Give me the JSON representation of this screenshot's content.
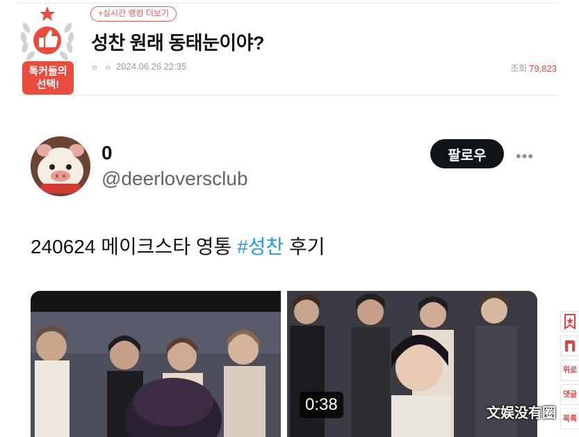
{
  "header": {
    "badge_text": [
      "톡커들의",
      "선택!"
    ],
    "ranking_link": "+실시간 랭킹 더보기",
    "title": "성찬 원래 동태눈이야?",
    "author_dots": "ㅇ ㅇ",
    "date": "2024.06.26 22:35",
    "views_label": "조회",
    "views_count": "79,823"
  },
  "tweet": {
    "display_name": "0",
    "handle": "@deerloversclub",
    "follow_label": "팔로우",
    "more_icon": "more-horizontal-icon",
    "text_prefix": "240624 메이크스타 영통 ",
    "hashtag": "#성찬",
    "text_suffix": " 후기",
    "video_duration": "0:38"
  },
  "side_menu": {
    "bookmark_icon": "bookmark-icon",
    "n_icon": "n-logo-icon",
    "top_label": "위로",
    "comment_label": "댓글",
    "list_label": "목록"
  },
  "overlay": {
    "watermark": "文娱没有圈"
  },
  "colors": {
    "brand_red": "#e94b3c",
    "hashtag_blue": "#1d9bf0",
    "follow_bg": "#0f1419"
  }
}
